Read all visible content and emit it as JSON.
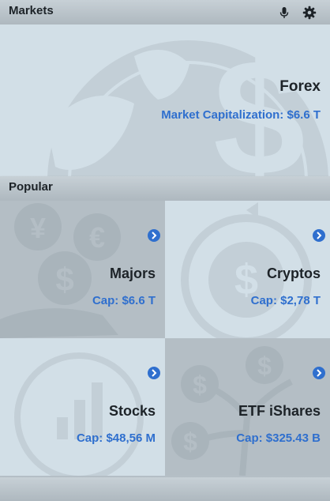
{
  "header": {
    "title": "Markets",
    "mic_icon": "microphone-icon",
    "settings_icon": "gear-icon"
  },
  "featured": {
    "title": "Forex",
    "cap": "Market Capitalization: $6.6 T"
  },
  "popular": {
    "title": "Popular"
  },
  "tiles": [
    {
      "title": "Majors",
      "cap": "Cap: $6.6 T"
    },
    {
      "title": "Cryptos",
      "cap": "Cap: $2,78 T"
    },
    {
      "title": "Stocks",
      "cap": "Cap: $48,56 M"
    },
    {
      "title": "ETF iShares",
      "cap": "Cap: $325.43 B"
    }
  ],
  "colors": {
    "accent": "#2f6fce",
    "bar": "#b7c1c8",
    "tile_light": "#d2dfe7",
    "tile_dark": "#b4bec5"
  }
}
